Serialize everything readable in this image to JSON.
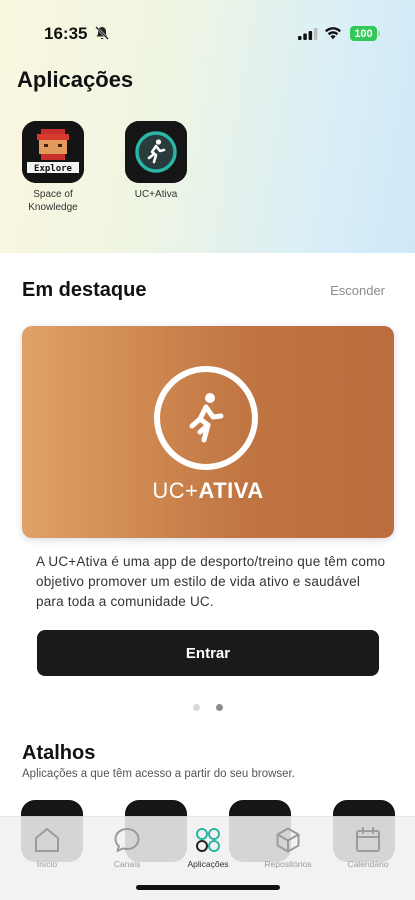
{
  "status_bar": {
    "time": "16:35",
    "battery": "100",
    "icons": [
      "bell-off-icon",
      "signal-icon",
      "wifi-icon",
      "battery-icon"
    ]
  },
  "applications": {
    "title": "Aplicações",
    "apps": [
      {
        "name": "Space of Knowledge",
        "icon": "space-of-knowledge-icon",
        "icon_text": "Explore"
      },
      {
        "name": "UC+Ativa",
        "icon": "uc-ativa-icon"
      }
    ]
  },
  "featured": {
    "title": "Em destaque",
    "hide_label": "Esconder",
    "banner": {
      "brand_light": "UC+",
      "brand_bold": "ATIVA",
      "icon": "running-person-icon"
    },
    "description": "A UC+Ativa é uma app de desporto/treino que têm como objetivo promover um estilo de vida ativo e saudável para toda a comunidade UC.",
    "button_label": "Entrar",
    "pagination": {
      "count": 2,
      "active_index": 1
    }
  },
  "shortcuts": {
    "title": "Atalhos",
    "subtitle": "Aplicações a que têm acesso a partir do seu browser."
  },
  "tab_bar": {
    "active": "Aplicações",
    "tabs": [
      {
        "label": "Início",
        "icon": "home-icon"
      },
      {
        "label": "Canais",
        "icon": "chat-bubble-icon"
      },
      {
        "label": "Aplicações",
        "icon": "apps-grid-icon"
      },
      {
        "label": "Repositórios",
        "icon": "cube-icon"
      },
      {
        "label": "Calendário",
        "icon": "calendar-icon"
      }
    ]
  },
  "colors": {
    "accent_teal": "#2bb5a4",
    "banner_orange": "#c97d48",
    "button_dark": "#1a1a1a",
    "battery_green": "#34c759"
  }
}
